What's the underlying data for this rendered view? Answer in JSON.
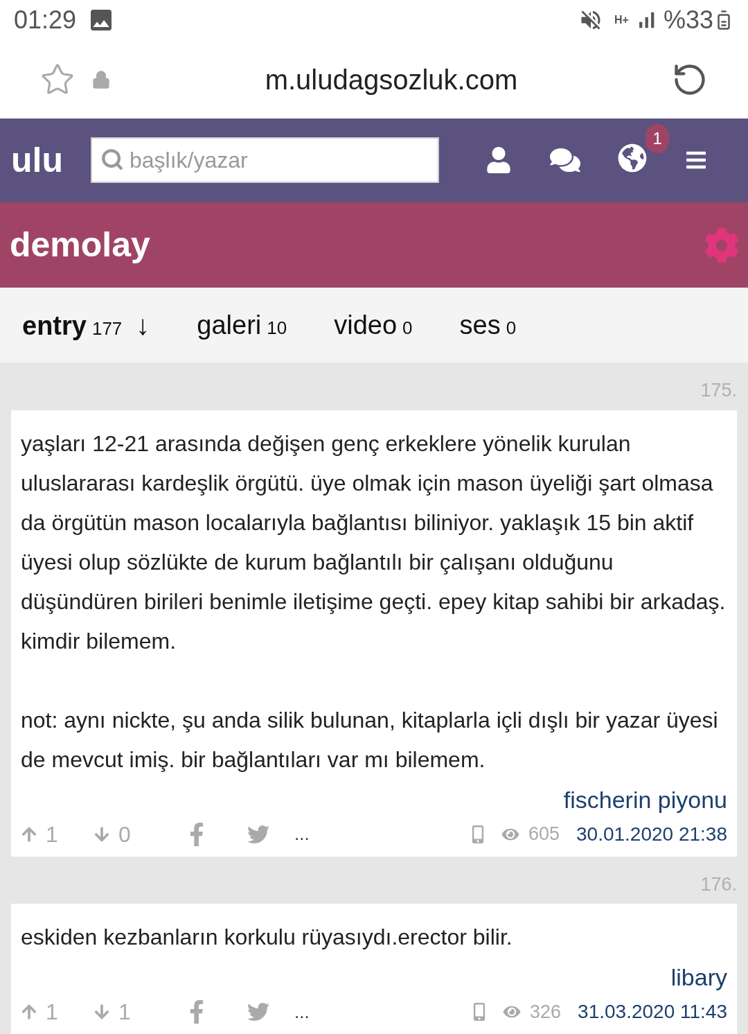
{
  "status_bar": {
    "time": "01:29",
    "network": "H+",
    "battery": "%33"
  },
  "browser": {
    "url": "m.uludagsozluk.com"
  },
  "nav": {
    "logo": "ulu",
    "search": {
      "placeholder": "başlık/yazar"
    },
    "notification_count": "1"
  },
  "topic": {
    "title": "demolay"
  },
  "tabs": [
    {
      "label": "entry",
      "count": "177",
      "selected": true,
      "sort": "↓"
    },
    {
      "label": "galeri",
      "count": "10",
      "selected": false
    },
    {
      "label": "video",
      "count": "0",
      "selected": false
    },
    {
      "label": "ses",
      "count": "0",
      "selected": false
    }
  ],
  "entries": [
    {
      "number": "175.",
      "paragraphs": [
        "yaşları 12-21 arasında değişen genç erkeklere yönelik kurulan uluslararası kardeşlik örgütü. üye olmak için mason üyeliği şart olmasa da örgütün mason localarıyla bağlantısı biliniyor. yaklaşık 15 bin aktif üyesi olup sözlükte de kurum bağlantılı bir çalışanı olduğunu düşündüren birileri benimle iletişime geçti. epey kitap sahibi bir arkadaş. kimdir bilemem.",
        "not: aynı nickte, şu anda silik bulunan, kitaplarla içli dışlı bir yazar üyesi de mevcut imiş. bir bağlantıları var mı bilemem."
      ],
      "author": "fischerin piyonu",
      "upvotes": "1",
      "downvotes": "0",
      "more": "...",
      "views": "605",
      "date": "30.01.2020 21:38"
    },
    {
      "number": "176.",
      "paragraphs": [
        "eskiden kezbanların korkulu rüyasıydı.erector bilir."
      ],
      "author": "libary",
      "upvotes": "1",
      "downvotes": "1",
      "more": "...",
      "views": "326",
      "date": "31.03.2020 11:43"
    }
  ]
}
